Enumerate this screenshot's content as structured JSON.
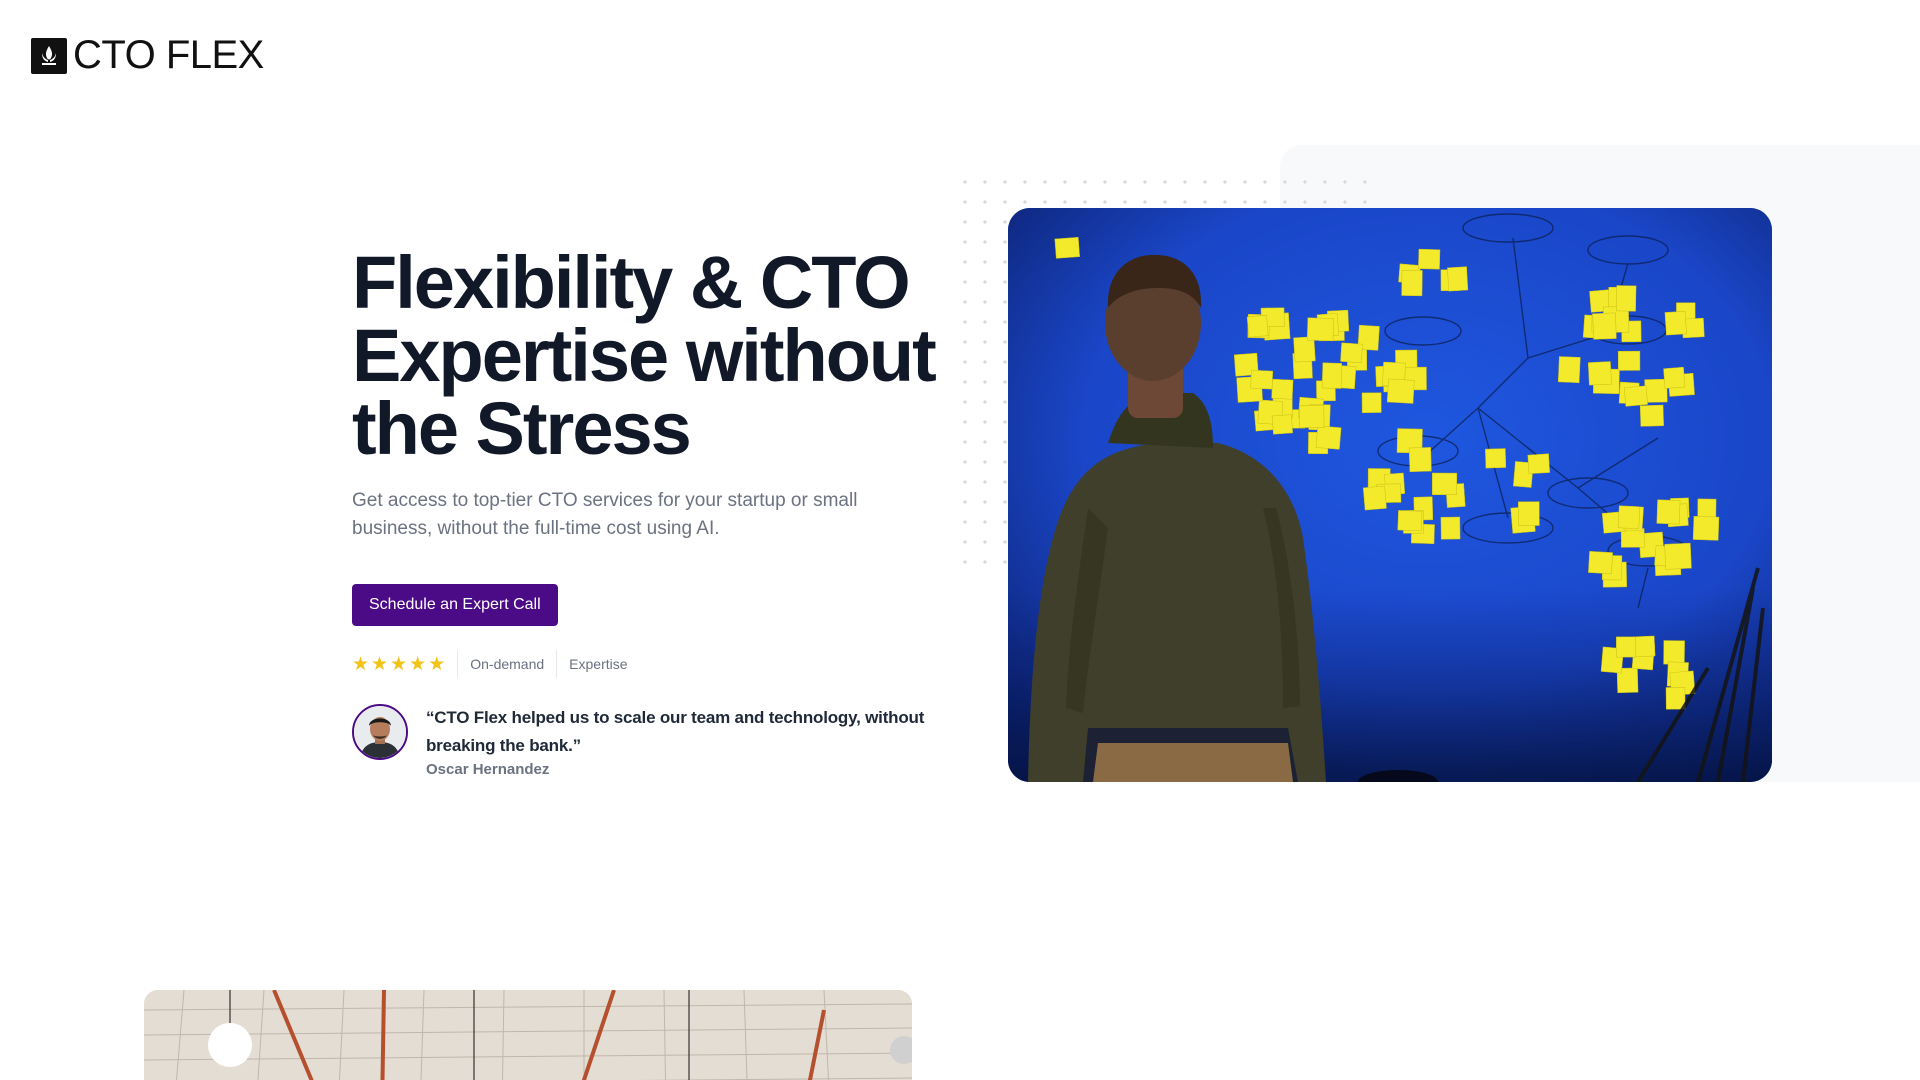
{
  "brand": {
    "name": "CTO FLEX",
    "logo_icon": "flame-leaf-icon"
  },
  "hero": {
    "title": "Flexibility & CTO Expertise without the Stress",
    "subtitle": "Get access to top-tier CTO services for your startup or small business, without the full-time cost using AI.",
    "cta_label": "Schedule an Expert Call",
    "rating_stars": 5,
    "tags": [
      "On-demand",
      "Expertise"
    ]
  },
  "testimonial": {
    "quote": "“CTO Flex helped us to scale our team and technology, without breaking the bank.”",
    "author": "Oscar Hernandez"
  },
  "colors": {
    "accent": "#4c0b86",
    "star": "#f2c318",
    "heading": "#111827",
    "muted": "#6b7280",
    "wall_blue": "#1a46c8",
    "sticky_yellow": "#f3ea2c"
  }
}
